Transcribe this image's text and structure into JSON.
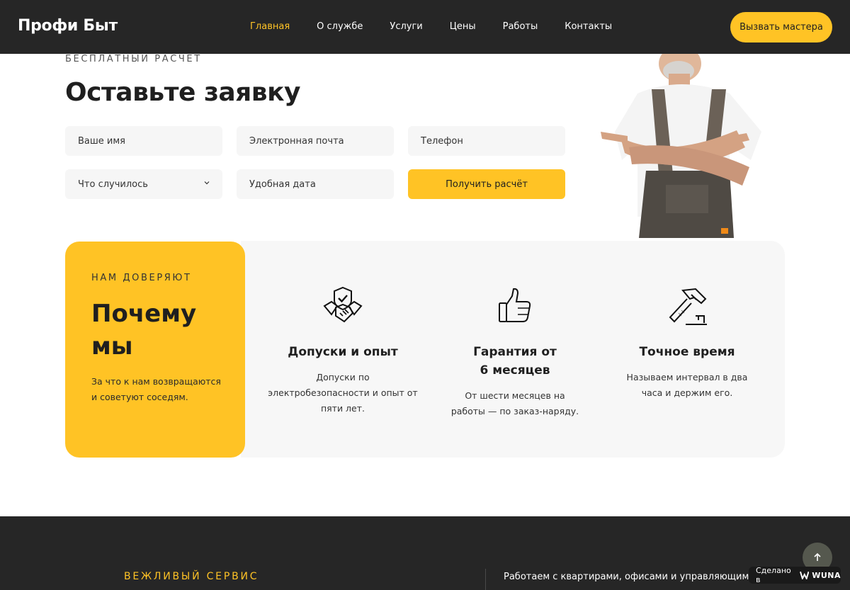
{
  "header": {
    "logo": "Профи Быт",
    "nav": [
      "Главная",
      "О службе",
      "Услуги",
      "Цены",
      "Работы",
      "Контакты"
    ],
    "active_nav": "Главная",
    "cta": "Вызвать мастера"
  },
  "form": {
    "eyebrow": "БЕСПЛАТНЫЙ РАСЧЁТ",
    "title": "Оставьте заявку",
    "fields": {
      "name": "Ваше имя",
      "email": "Электронная почта",
      "phone": "Телефон",
      "issue": "Что случилось",
      "date": "Удобная дата"
    },
    "submit": "Получить расчёт"
  },
  "why": {
    "eyebrow": "НАМ ДОВЕРЯЮТ",
    "title_line1": "Почему",
    "title_line2": "мы",
    "text": "За что к нам возвращаются и советуют соседям.",
    "features": [
      {
        "icon": "handshake-shield-icon",
        "title": "Допуски и опыт",
        "text": "Допуски по электробезопасности и опыт от пяти лет."
      },
      {
        "icon": "thumbs-up-icon",
        "title": "Гарантия от 6 месяцев",
        "text": "От шести месяцев на работы — по заказ-наряду."
      },
      {
        "icon": "hammer-icon",
        "title": "Точное время",
        "text": "Называем интервал в два часа и держим его."
      }
    ]
  },
  "footer": {
    "eyebrow": "ВЕЖЛИВЫЙ СЕРВИС",
    "text": "Работаем с квартирами, офисами и управляющими"
  },
  "badge": {
    "prefix": "Сделано в",
    "brand": "WUNA"
  },
  "colors": {
    "accent": "#ffc325",
    "dark": "#262626",
    "light_panel": "#f7f7f7"
  }
}
